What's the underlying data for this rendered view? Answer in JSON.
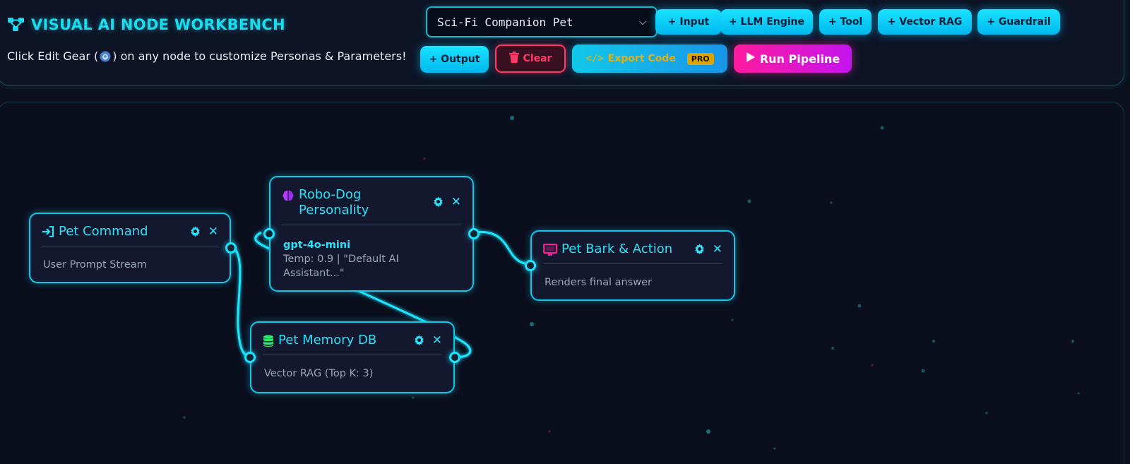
{
  "app": {
    "title": "VISUAL AI NODE WORKBENCH",
    "subtitle_before": "Click Edit Gear (",
    "subtitle_after": ") on any node to customize Personas & Parameters!"
  },
  "toolbar": {
    "preset_value": "Sci-Fi Companion Pet",
    "buttons": {
      "input": "+ Input",
      "llm": "+ LLM Engine",
      "tool": "+ Tool",
      "vector_rag": "+ Vector RAG",
      "guardrail": "+ Guardrail",
      "output": "+ Output",
      "clear": "Clear",
      "export": "Export Code",
      "export_badge": "PRO",
      "run": "Run Pipeline"
    }
  },
  "colors": {
    "accent": "#19dcf0",
    "danger": "#ff3a6a",
    "pro_badge": "#f5b400",
    "run_start": "#ff1a9c",
    "run_end": "#c414f0"
  },
  "nodes": {
    "pet_command": {
      "icon": "sign-in-icon",
      "title": "Pet Command",
      "body": "User Prompt Stream"
    },
    "robo_dog": {
      "icon": "brain-icon",
      "title": "Robo-Dog Personality",
      "model": "gpt-4o-mini",
      "details": "Temp: 0.9 | \"Default AI Assistant...\""
    },
    "pet_bark": {
      "icon": "monitor-icon",
      "title": "Pet Bark & Action",
      "body": "Renders final answer"
    },
    "pet_memory": {
      "icon": "database-icon",
      "title": "Pet Memory DB",
      "body": "Vector RAG (Top K: 3)"
    }
  },
  "icons": {
    "app_logo": "network-nodes-icon",
    "gear": "gear-icon",
    "close": "close-icon",
    "clear": "trash-icon",
    "export": "code-icon",
    "run": "play-icon",
    "select": "chevron-down-icon"
  }
}
